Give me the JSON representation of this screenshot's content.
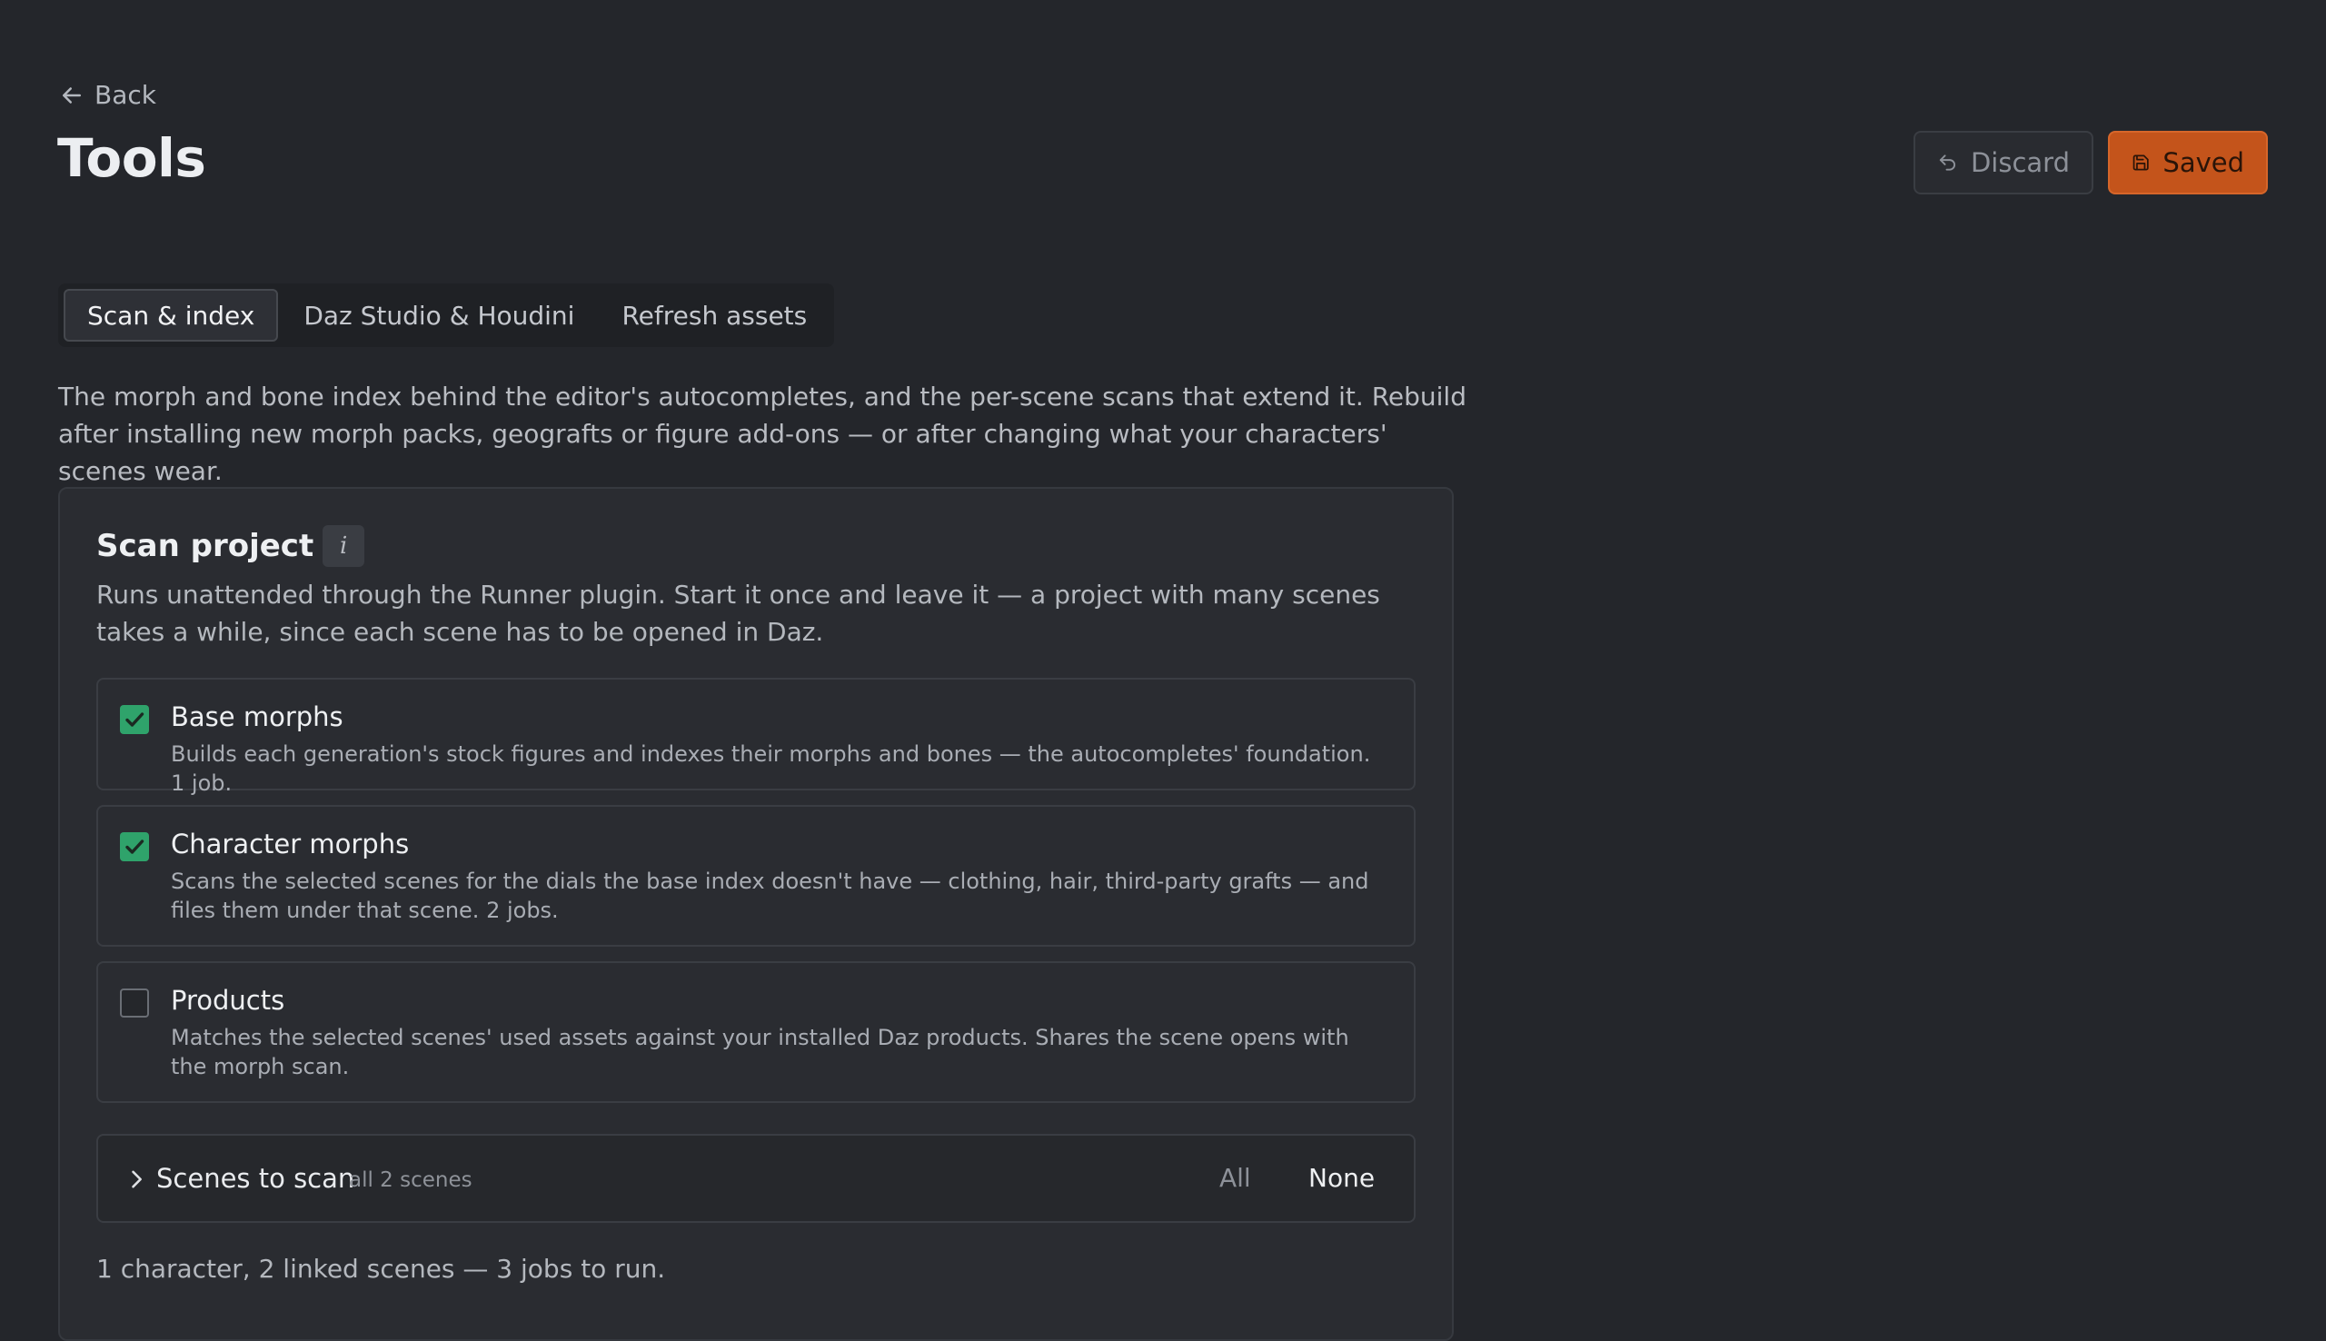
{
  "header": {
    "back_label": "Back",
    "title": "Tools",
    "discard_label": "Discard",
    "saved_label": "Saved"
  },
  "tabs": [
    {
      "label": "Scan & index",
      "active": true
    },
    {
      "label": "Daz Studio & Houdini",
      "active": false
    },
    {
      "label": "Refresh assets",
      "active": false
    }
  ],
  "intro": "The morph and bone index behind the editor's autocompletes, and the per-scene scans that extend it. Rebuild after installing new morph packs, geografts or figure add-ons — or after changing what your characters' scenes wear.",
  "scan_project": {
    "title": "Scan project",
    "info_icon": "i",
    "description": "Runs unattended through the Runner plugin. Start it once and leave it — a project with many scenes takes a while, since each scene has to be opened in Daz.",
    "options": [
      {
        "label": "Base morphs",
        "checked": true,
        "description": "Builds each generation's stock figures and indexes their morphs and bones — the autocompletes' foundation. 1 job."
      },
      {
        "label": "Character morphs",
        "checked": true,
        "description": "Scans the selected scenes for the dials the base index doesn't have — clothing, hair, third-party grafts — and files them under that scene. 2 jobs."
      },
      {
        "label": "Products",
        "checked": false,
        "description": "Matches the selected scenes' used assets against your installed Daz products. Shares the scene opens with the morph scan."
      }
    ],
    "scenes": {
      "title": "Scenes to scan",
      "meta": "all 2 scenes",
      "all_label": "All",
      "none_label": "None"
    },
    "summary": "1 character, 2 linked scenes — 3 jobs to run."
  },
  "colors": {
    "background": "#24262b",
    "accent": "#c4541b",
    "checkbox_on": "#2fa36b"
  }
}
